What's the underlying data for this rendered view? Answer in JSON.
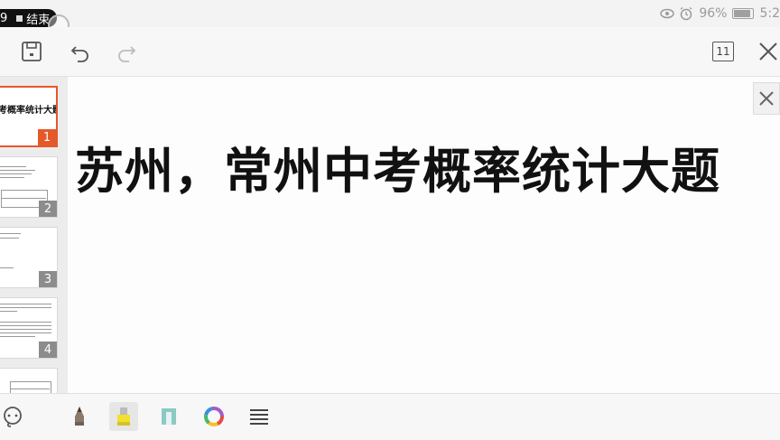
{
  "status_bar": {
    "recording_time": "9",
    "recording_label": "结束",
    "battery": "96%",
    "time": "5:2"
  },
  "toolbar": {
    "save_icon": "save-icon",
    "undo_icon": "undo-icon",
    "redo_icon": "redo-icon",
    "slide_count": "11",
    "close_icon": "close-icon"
  },
  "thumbnails": [
    {
      "number": "1",
      "title": "考概率统计大题",
      "active": true
    },
    {
      "number": "2",
      "active": false
    },
    {
      "number": "3",
      "active": false
    },
    {
      "number": "4",
      "active": false
    }
  ],
  "slide": {
    "title": "苏州，常州中考概率统计大题"
  },
  "bottom_tools": [
    "lasso-icon",
    "pen-icon",
    "highlighter-icon",
    "eraser-icon",
    "color-wheel-icon",
    "menu-icon"
  ],
  "colors": {
    "accent": "#e5582a",
    "highlighter": "#f2df2e"
  }
}
